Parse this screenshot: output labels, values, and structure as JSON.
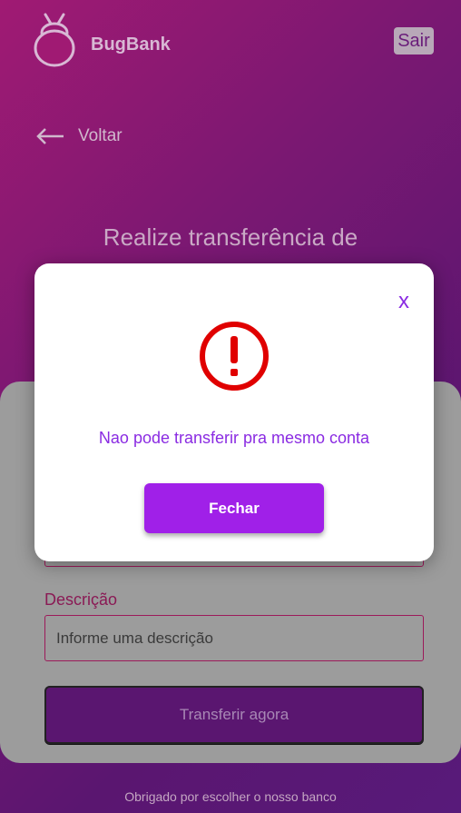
{
  "header": {
    "logo_text": "BugBank",
    "logout_label": "Sair"
  },
  "nav": {
    "back_label": "Voltar"
  },
  "page": {
    "title": "Realize transferência de"
  },
  "form": {
    "description_label": "Descrição",
    "description_placeholder": "Informe uma descrição",
    "submit_label": "Transferir agora"
  },
  "footer": {
    "text": "Obrigado por escolher o nosso banco"
  },
  "modal": {
    "close_label": "x",
    "message": "Nao pode transferir pra mesmo conta",
    "button_label": "Fechar",
    "icon": "error-icon"
  },
  "colors": {
    "accent": "#a020e8",
    "modal_text": "#8a2be2",
    "error_red": "#e00000"
  }
}
